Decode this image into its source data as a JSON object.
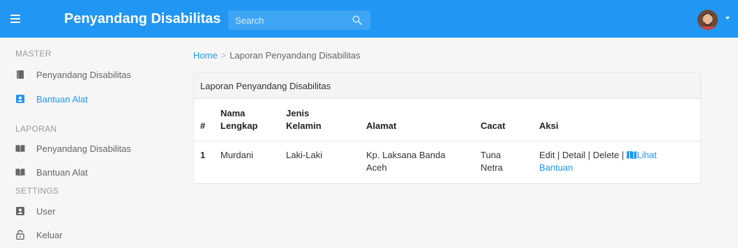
{
  "header": {
    "brand": "Penyandang Disabilitas",
    "search_placeholder": "Search"
  },
  "sidebar": {
    "sections": [
      {
        "heading": "MASTER",
        "items": [
          {
            "label": "Penyandang Disabilitas",
            "icon": "book-icon"
          },
          {
            "label": "Bantuan Alat",
            "icon": "id-card-icon"
          }
        ]
      },
      {
        "heading": "LAPORAN",
        "items": [
          {
            "label": "Penyandang Disabilitas",
            "icon": "open-book-icon"
          },
          {
            "label": "Bantuan Alat",
            "icon": "open-book-icon"
          }
        ]
      },
      {
        "heading": "SETTINGS",
        "items": [
          {
            "label": "User",
            "icon": "id-card-icon"
          },
          {
            "label": "Keluar",
            "icon": "lock-icon"
          }
        ]
      }
    ]
  },
  "breadcrumb": {
    "home": "Home",
    "separator": ">",
    "current": "Laporan Penyandang Disabilitas"
  },
  "card": {
    "title": "Laporan Penyandang Disabilitas",
    "columns": {
      "no": "#",
      "nama_1": "Nama",
      "nama_2": "Lengkap",
      "jenis_1": "Jenis",
      "jenis_2": "Kelamin",
      "alamat": "Alamat",
      "cacat": "Cacat",
      "aksi": "Aksi"
    },
    "rows": [
      {
        "no": "1",
        "nama": "Murdani",
        "jenis": "Laki-Laki",
        "alamat_1": "Kp. Laksana Banda",
        "alamat_2": "Aceh",
        "cacat_1": "Tuna",
        "cacat_2": "Netra",
        "edit": "Edit",
        "detail": "Detail",
        "delete": "Delete",
        "pipe": "|",
        "lihat_1": "Lihat",
        "lihat_2": "Bantuan"
      }
    ]
  },
  "colors": {
    "primary": "#2196f3",
    "background": "#f6f6f6"
  }
}
